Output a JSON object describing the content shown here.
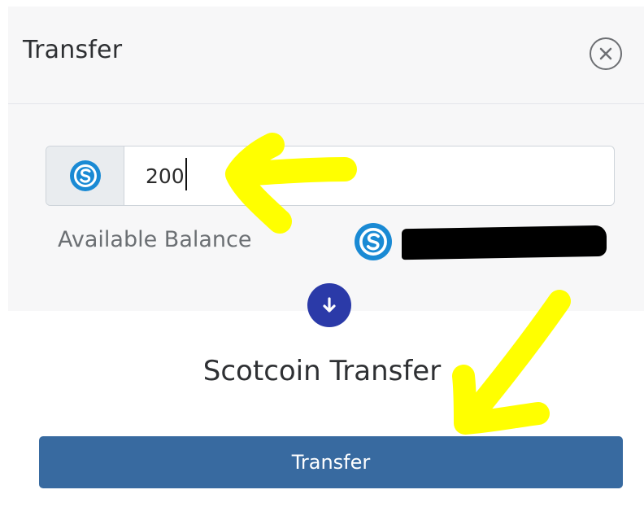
{
  "modal": {
    "title": "Transfer",
    "close_icon": "close-circle-icon"
  },
  "amount": {
    "value": "200",
    "currency_icon": "scotcoin-icon"
  },
  "balance": {
    "label": "Available Balance",
    "currency_icon": "scotcoin-icon",
    "value_redacted": true
  },
  "direction_icon": "arrow-down-circle-icon",
  "section": {
    "title": "Scotcoin Transfer"
  },
  "actions": {
    "transfer_label": "Transfer"
  },
  "colors": {
    "primary_button": "#386aa0",
    "coin": "#1a8ad4",
    "direction_circle": "#2b3aa8",
    "annotation": "#ffff00"
  }
}
